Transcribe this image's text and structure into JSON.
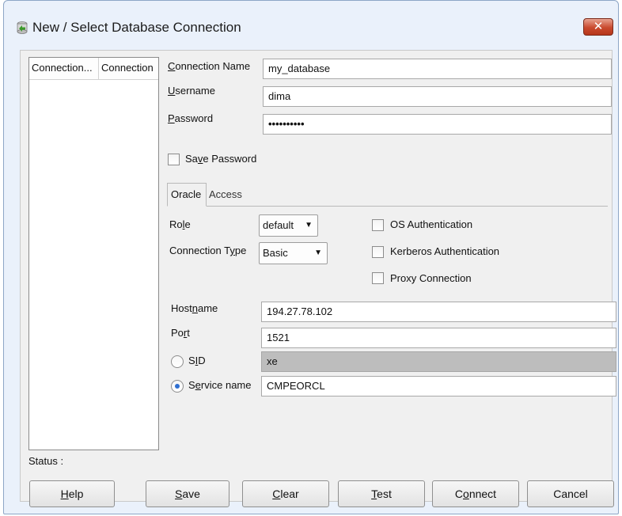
{
  "window": {
    "title": "New / Select Database Connection",
    "close_glyph": "✕"
  },
  "list": {
    "col1": "Connection...",
    "col2": "Connection"
  },
  "form": {
    "connection_name_label": "Connection Name",
    "connection_name_value": "my_database",
    "username_label": "Username",
    "username_value": "dima",
    "password_label": "Password",
    "password_value": "••••••••••",
    "save_password_label": "Save Password",
    "save_password_checked": false
  },
  "tabs": {
    "oracle": "Oracle",
    "access": "Access"
  },
  "oracle": {
    "role_label": "Role",
    "role_value": "default",
    "connection_type_label": "Connection Type",
    "connection_type_value": "Basic",
    "os_auth_label": "OS Authentication",
    "kerberos_label": "Kerberos Authentication",
    "proxy_label": "Proxy Connection",
    "hostname_label": "Hostname",
    "hostname_value": "194.27.78.102",
    "port_label": "Port",
    "port_value": "1521",
    "sid_label": "SID",
    "sid_value": "xe",
    "service_name_label": "Service name",
    "service_name_value": "CMPEORCL",
    "selected_mode": "Service name"
  },
  "status_label": "Status :",
  "buttons": {
    "help": "Help",
    "save": "Save",
    "clear": "Clear",
    "test": "Test",
    "connect": "Connect",
    "cancel": "Cancel"
  },
  "colors": {
    "window_bg": "#eaf1fb",
    "client_bg": "#f0f0f0",
    "close": "#c94a2e",
    "radio_dot": "#2f6fd1"
  },
  "icons": {
    "app": "database-connection-icon",
    "close": "close-icon",
    "dropdown": "chevron-down-icon"
  }
}
